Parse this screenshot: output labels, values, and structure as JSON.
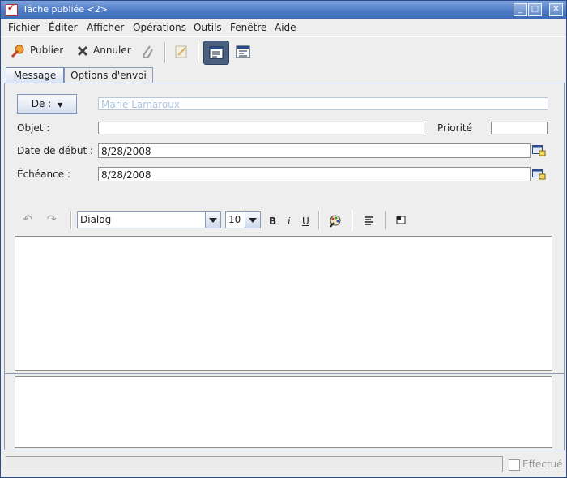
{
  "window": {
    "title": "Tâche publiée <2>",
    "controls": [
      "_",
      "□",
      "✕"
    ]
  },
  "menu": [
    {
      "label": "Fichier"
    },
    {
      "label": "Éditer"
    },
    {
      "label": "Afficher"
    },
    {
      "label": "Opérations"
    },
    {
      "label": "Outils"
    },
    {
      "label": "Fenêtre"
    },
    {
      "label": "Aide"
    }
  ],
  "toolbar": {
    "publish_label": "Publier",
    "cancel_label": "Annuler"
  },
  "tabs": [
    {
      "label": "Message",
      "active": true
    },
    {
      "label": "Options d'envoi",
      "active": false
    }
  ],
  "form": {
    "from_button": "De :",
    "from_value": "Marie Lamaroux",
    "subject_label": "Objet :",
    "subject_value": "",
    "priority_label": "Priorité",
    "priority_value": "",
    "start_label": "Date de début :",
    "start_value": "8/28/2008",
    "due_label": "Échéance :",
    "due_value": "8/28/2008"
  },
  "editor": {
    "font_value": "Dialog",
    "size_value": "10",
    "bold": "B",
    "italic": "i",
    "underline": "U"
  },
  "status": {
    "text": "",
    "done_label": "Effectué",
    "done_checked": false
  },
  "colors": {
    "titlebar": "#4a78c4",
    "tab_active": "#d9e3f3",
    "accent": "#6f88b8"
  }
}
